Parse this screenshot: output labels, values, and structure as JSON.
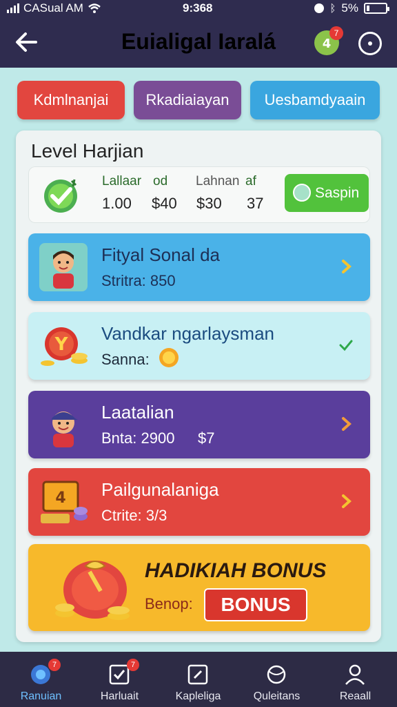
{
  "status": {
    "carrier": "CASual AM",
    "time": "9:368",
    "battery": "5%",
    "battery_level": 0.15
  },
  "header": {
    "title": "Euialigal Iaralá",
    "coin_badge": "7"
  },
  "tabs": [
    {
      "label": "Kdmlnanjai"
    },
    {
      "label": "Rkadiaiayan"
    },
    {
      "label": "Uesbamdyaain"
    }
  ],
  "level": {
    "title": "Level Harjian",
    "stats": [
      {
        "label": "Lallaar",
        "value": "1.00"
      },
      {
        "label": "od",
        "value": "$40"
      },
      {
        "label": "Lahnan",
        "value": "$30"
      },
      {
        "label": "af",
        "value": "37"
      }
    ],
    "button_label": "Saspin"
  },
  "tasks": [
    {
      "title": "Fityal Sonal da",
      "sub": "Stritra: 850"
    },
    {
      "title": "Vandkar ngarlaysman",
      "sub": "Sanna:"
    },
    {
      "title": "Laatalian",
      "sub": "Bnta: 2900",
      "sub_extra": "$7"
    },
    {
      "title": "Pailgunalaniga",
      "sub": "Ctrite: 3/3"
    }
  ],
  "bonus": {
    "title": "HADIKIAH BONUS",
    "label": "Benop:",
    "button_label": "BONUS"
  },
  "nav": [
    {
      "label": "Ranuian",
      "badge": "7",
      "icon": "home-icon"
    },
    {
      "label": "Harluait",
      "badge": "7",
      "icon": "tasks-icon"
    },
    {
      "label": "Kapleliga",
      "icon": "game-icon"
    },
    {
      "label": "Quleitans",
      "icon": "globe-icon"
    },
    {
      "label": "Reaall",
      "icon": "profile-icon"
    }
  ],
  "colors": {
    "header_bg": "#2f2c4f",
    "page_bg": "#bfe9e8",
    "tab_red": "#e2463f",
    "tab_purple": "#7a4d96",
    "tab_blue": "#3aa6df",
    "accent_green": "#52c23c",
    "bonus_yellow": "#f7b92b",
    "nav_active": "#6fc0ff"
  }
}
